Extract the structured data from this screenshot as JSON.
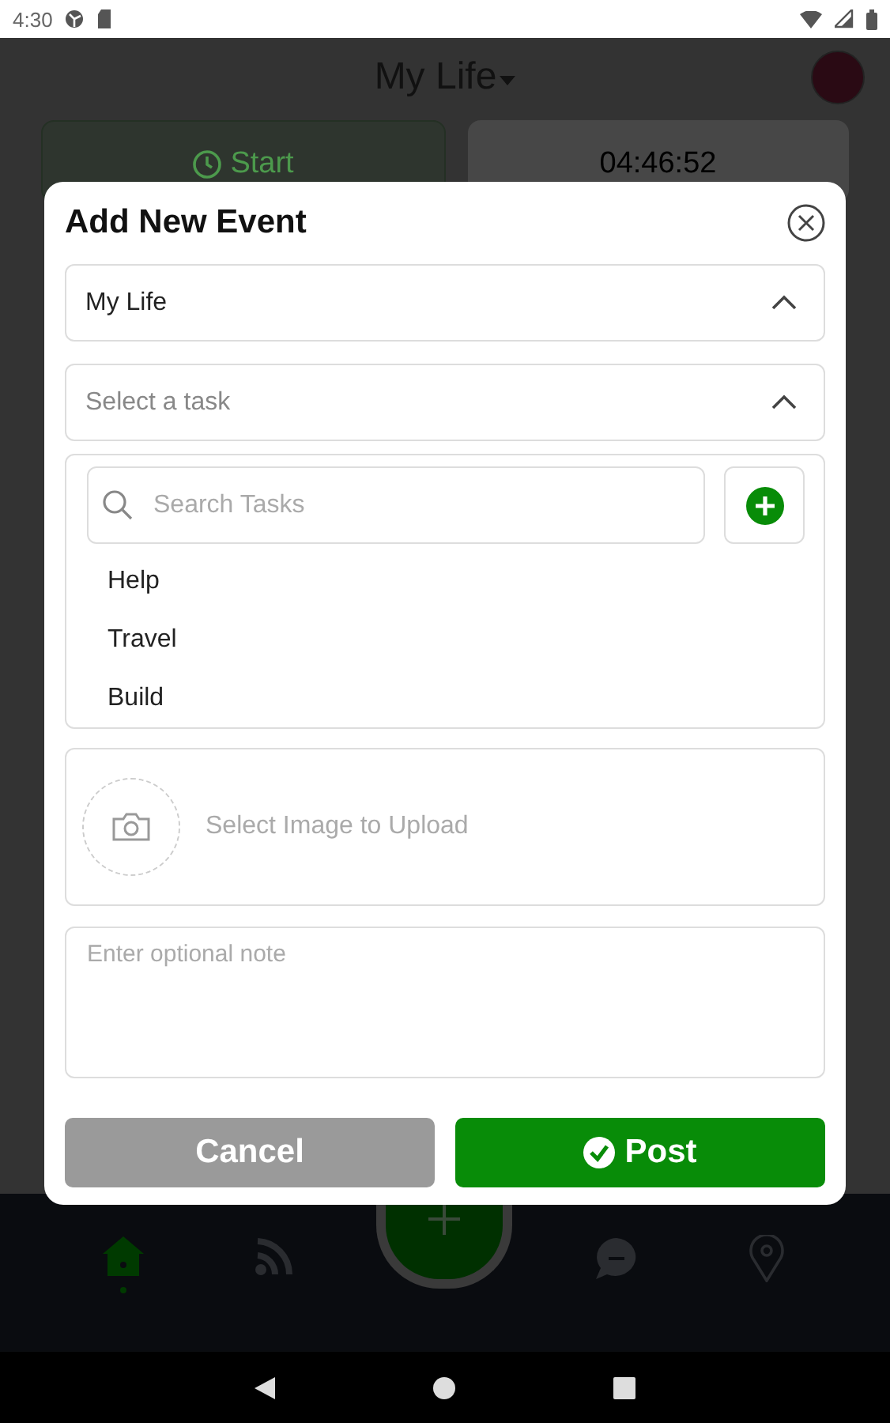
{
  "status_bar": {
    "time": "4:30"
  },
  "header": {
    "title": "My Life"
  },
  "timer_cards": {
    "start_label": "Start",
    "timer": "04:46:52"
  },
  "bottom_nav": [
    {
      "kind": "home",
      "selected": true
    },
    {
      "kind": "feed",
      "selected": false
    },
    {
      "kind": "add",
      "selected": false
    },
    {
      "kind": "chat",
      "selected": false
    },
    {
      "kind": "location",
      "selected": false
    }
  ],
  "dialog": {
    "title": "Add New Event",
    "category_dropdown": {
      "value": "My Life",
      "expanded": true
    },
    "task_dropdown": {
      "placeholder": "Select a task",
      "expanded": true
    },
    "task_search": {
      "placeholder": "Search Tasks"
    },
    "tasks": [
      "Help",
      "Travel",
      "Build"
    ],
    "image_upload": {
      "label": "Select Image to Upload"
    },
    "note": {
      "placeholder": "Enter optional note"
    },
    "cancel_button": "Cancel",
    "post_button": "Post"
  }
}
